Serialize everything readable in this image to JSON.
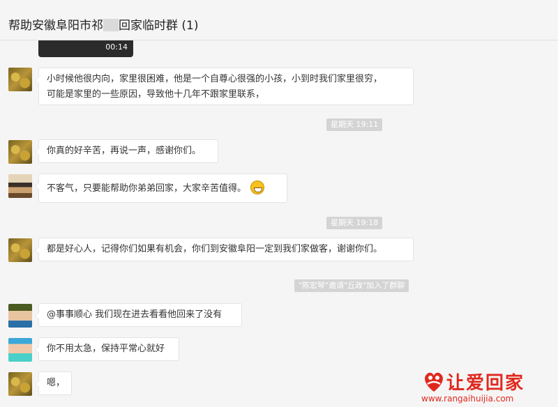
{
  "header": {
    "title_prefix": "帮助安徽阜阳市祁",
    "title_suffix": "回家临时群 (1)"
  },
  "video": {
    "duration": "00:14"
  },
  "messages": [
    {
      "line1": "小时候他很内向，家里很困难，他是一个自尊心很强的小孩，小到时我们家里很穷，",
      "line2": "可能是家里的一些原因，导致他十几年不跟家里联系，"
    },
    {
      "text": "你真的好辛苦，再说一声，感谢你们。"
    },
    {
      "text": "不客气，只要能帮助你弟弟回家，大家辛苦值得。"
    },
    {
      "text": "都是好心人，记得你们如果有机会，你们到安徽阜阳一定到我们家做客，谢谢你们。"
    },
    {
      "text": "@事事顺心 我们现在进去看看他回来了没有"
    },
    {
      "text": "你不用太急，保持平常心就好"
    },
    {
      "text": "嗯，"
    }
  ],
  "timestamps": [
    "星期天 19:11",
    "星期天 19:18"
  ],
  "system_notice": "\"陈宏琴\"邀请\"丘政\"加入了群聊",
  "watermark": {
    "brand": "让爱回家",
    "url": "www.rangaihuijia.com"
  }
}
